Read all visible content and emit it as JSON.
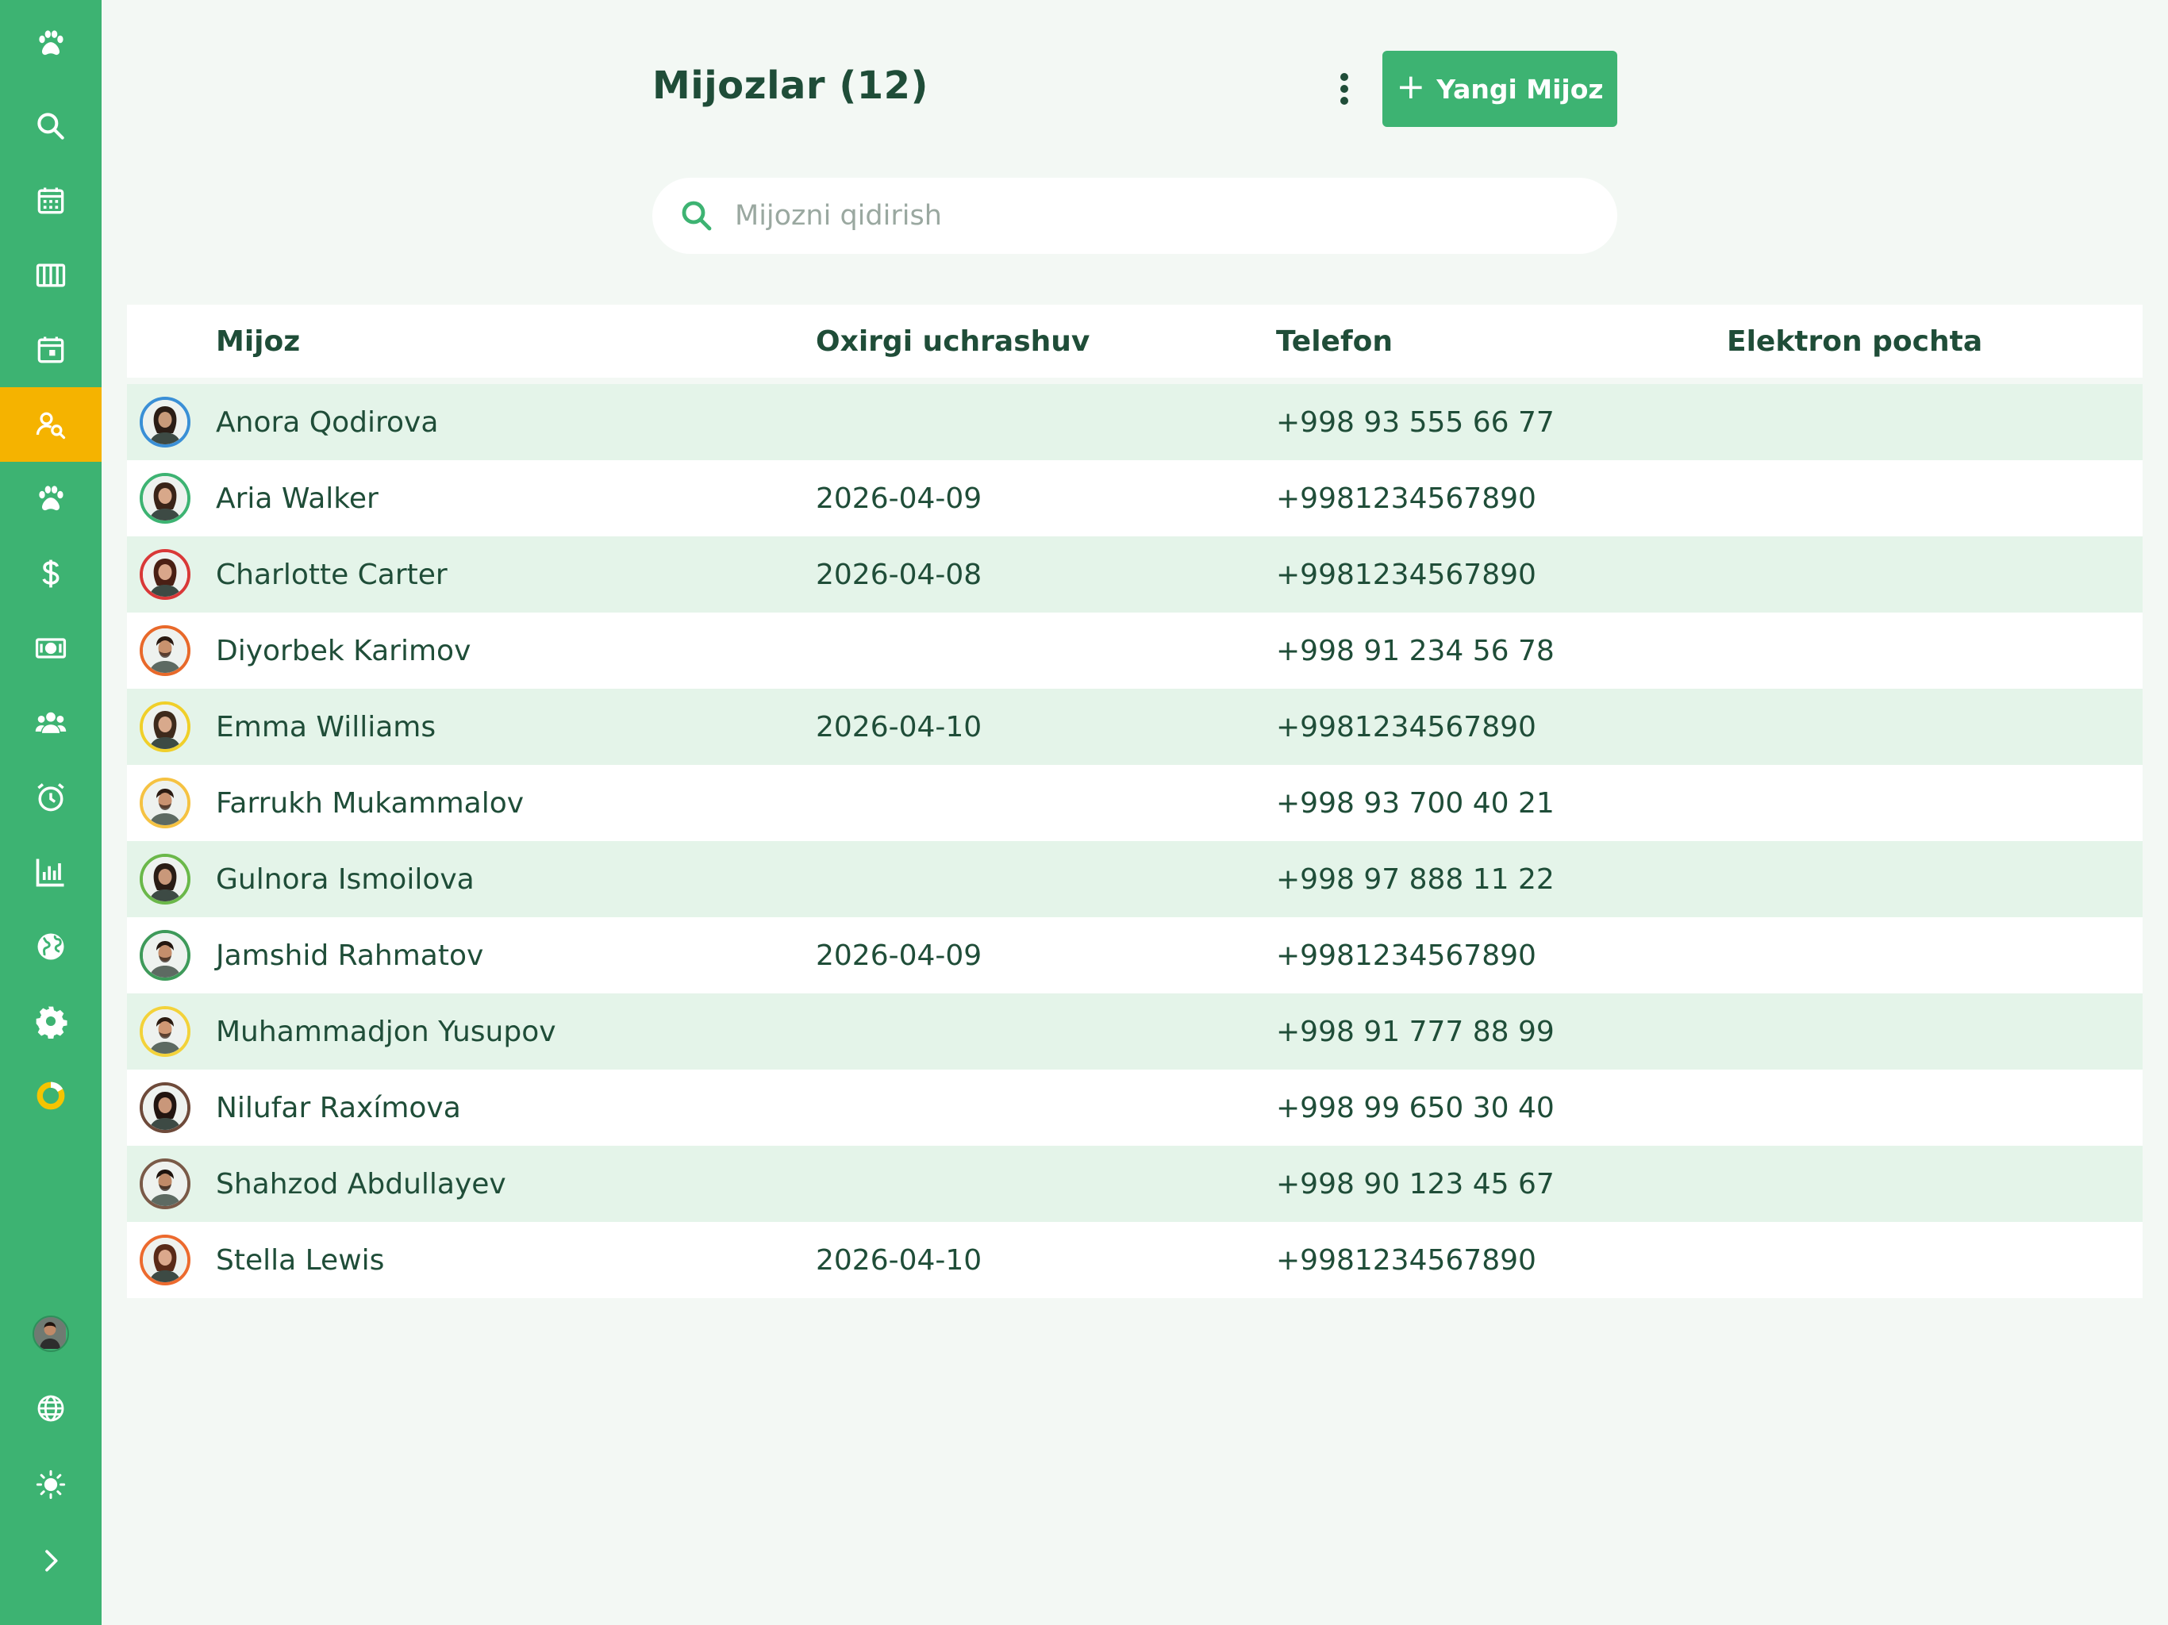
{
  "sidebar": {
    "items": [
      {
        "icon": "paw-icon",
        "name": "sidebar-item-logo"
      },
      {
        "icon": "search-icon",
        "name": "sidebar-item-search"
      },
      {
        "icon": "calendar-icon",
        "name": "sidebar-item-calendar"
      },
      {
        "icon": "columns-icon",
        "name": "sidebar-item-board"
      },
      {
        "icon": "calendar-day-icon",
        "name": "sidebar-item-schedule"
      },
      {
        "icon": "client-search-icon",
        "name": "sidebar-item-clients",
        "active": true
      },
      {
        "icon": "paw-icon",
        "name": "sidebar-item-pets"
      },
      {
        "icon": "dollar-icon",
        "name": "sidebar-item-sales"
      },
      {
        "icon": "cash-icon",
        "name": "sidebar-item-payments"
      },
      {
        "icon": "users-icon",
        "name": "sidebar-item-staff"
      },
      {
        "icon": "alarm-icon",
        "name": "sidebar-item-reminders"
      },
      {
        "icon": "bar-chart-icon",
        "name": "sidebar-item-reports"
      },
      {
        "icon": "globe-icon",
        "name": "sidebar-item-website"
      },
      {
        "icon": "gear-icon",
        "name": "sidebar-item-settings"
      },
      {
        "icon": "progress-ring-icon",
        "name": "sidebar-item-progress"
      }
    ],
    "bottom": [
      {
        "icon": "user-avatar",
        "name": "sidebar-user-avatar"
      },
      {
        "icon": "language-globe-icon",
        "name": "sidebar-language"
      },
      {
        "icon": "sun-icon",
        "name": "sidebar-theme-toggle"
      },
      {
        "icon": "chevron-right-icon",
        "name": "sidebar-expand"
      }
    ],
    "accent": "#3db372",
    "active_color": "#f5b300"
  },
  "header": {
    "title": "Mijozlar (12)",
    "add_button_label": "Yangi Mijoz"
  },
  "search": {
    "placeholder": "Mijozni qidirish",
    "value": ""
  },
  "table": {
    "headers": [
      "Mijoz",
      "Oxirgi uchrashuv",
      "Telefon",
      "Elektron pochta"
    ],
    "rows": [
      {
        "name": "Anora Qodirova",
        "last_visit": "",
        "phone": "+998 93 555 66 77",
        "email": "",
        "ring": "#3a8fd6",
        "skin": "#c89a7a",
        "hair": "#2b1d16",
        "gender": "f"
      },
      {
        "name": "Aria Walker",
        "last_visit": "2026-04-09",
        "phone": "+9981234567890",
        "email": "",
        "ring": "#3db372",
        "skin": "#d8a88a",
        "hair": "#3a2418",
        "gender": "f"
      },
      {
        "name": "Charlotte Carter",
        "last_visit": "2026-04-08",
        "phone": "+9981234567890",
        "email": "",
        "ring": "#d93838",
        "skin": "#d9a68a",
        "hair": "#4a1f14",
        "gender": "f"
      },
      {
        "name": "Diyorbek Karimov",
        "last_visit": "",
        "phone": "+998 91 234 56 78",
        "email": "",
        "ring": "#e8692a",
        "skin": "#c8926e",
        "hair": "#2a1a12",
        "gender": "m"
      },
      {
        "name": "Emma Williams",
        "last_visit": "2026-04-10",
        "phone": "+9981234567890",
        "email": "",
        "ring": "#f0cf2a",
        "skin": "#d8a98c",
        "hair": "#3e2a1c",
        "gender": "f"
      },
      {
        "name": "Farrukh Mukammalov",
        "last_visit": "",
        "phone": "+998 93 700 40 21",
        "email": "",
        "ring": "#f5c242",
        "skin": "#c99270",
        "hair": "#2b1b12",
        "gender": "m"
      },
      {
        "name": "Gulnora Ismoilova",
        "last_visit": "",
        "phone": "+998 97 888 11 22",
        "email": "",
        "ring": "#6bb84a",
        "skin": "#c9987a",
        "hair": "#2a1c15",
        "gender": "f"
      },
      {
        "name": "Jamshid Rahmatov",
        "last_visit": "2026-04-09",
        "phone": "+9981234567890",
        "email": "",
        "ring": "#3e9a5a",
        "skin": "#c48e6c",
        "hair": "#241710",
        "gender": "m"
      },
      {
        "name": "Muhammadjon Yusupov",
        "last_visit": "",
        "phone": "+998 91 777 88 99",
        "email": "",
        "ring": "#f3d23a",
        "skin": "#cf9874",
        "hair": "#2c1c12",
        "gender": "m"
      },
      {
        "name": "Nilufar Raxímova",
        "last_visit": "",
        "phone": "+998 99 650 30 40",
        "email": "",
        "ring": "#6e4a3a",
        "skin": "#c9977a",
        "hair": "#221510",
        "gender": "f"
      },
      {
        "name": "Shahzod Abdullayev",
        "last_visit": "",
        "phone": "+998 90 123 45 67",
        "email": "",
        "ring": "#7a5a48",
        "skin": "#c08a68",
        "hair": "#1f140e",
        "gender": "m"
      },
      {
        "name": "Stella Lewis",
        "last_visit": "2026-04-10",
        "phone": "+9981234567890",
        "email": "",
        "ring": "#ec6a2e",
        "skin": "#dba88c",
        "hair": "#5a2a18",
        "gender": "f"
      }
    ]
  }
}
